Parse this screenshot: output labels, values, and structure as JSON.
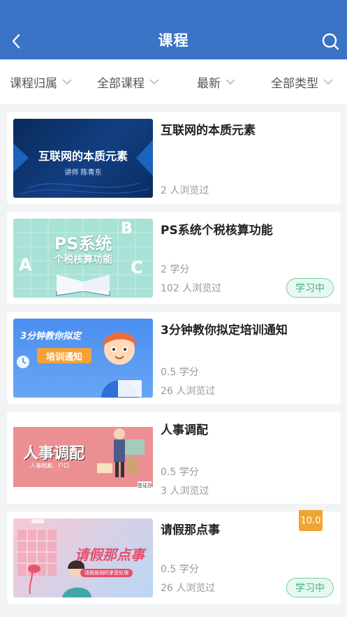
{
  "header": {
    "title": "课程"
  },
  "filters": [
    {
      "label": "课程归属"
    },
    {
      "label": "全部课程"
    },
    {
      "label": "最新"
    },
    {
      "label": "全部类型"
    }
  ],
  "courses": [
    {
      "title": "互联网的本质元素",
      "credits": "",
      "views": "2 人浏览过",
      "status": "",
      "score": "",
      "thumb": {
        "main": "互联网的本质元素",
        "sub": "讲师 陈青东"
      }
    },
    {
      "title": "PS系统个税核算功能",
      "credits": "2 学分",
      "views": "102 人浏览过",
      "status": "学习中",
      "score": "",
      "thumb": {
        "main": "PS系统",
        "sub": "个税核算功能",
        "letters": [
          "A",
          "B",
          "C"
        ]
      }
    },
    {
      "title": "3分钟教你拟定培训通知",
      "credits": "0.5 学分",
      "views": "26 人浏览过",
      "status": "",
      "score": "",
      "thumb": {
        "main": "3分钟教你拟定",
        "sub": "培训通知"
      }
    },
    {
      "title": "人事调配",
      "credits": "0.5 学分",
      "views": "3 人浏览过",
      "status": "",
      "score": "",
      "thumb": {
        "main": "人事调配",
        "sub": "人事档案、户口",
        "tag": "签证办"
      }
    },
    {
      "title": "请假那点事",
      "credits": "0.5 学分",
      "views": "26 人浏览过",
      "status": "学习中",
      "score": "10.0",
      "thumb": {
        "main": "请假那点事",
        "sub": "请假报销时承受处理"
      }
    }
  ],
  "colors": {
    "header": "#3a73c6",
    "badge_green": "#39b47e",
    "score_orange": "#f0a532"
  }
}
